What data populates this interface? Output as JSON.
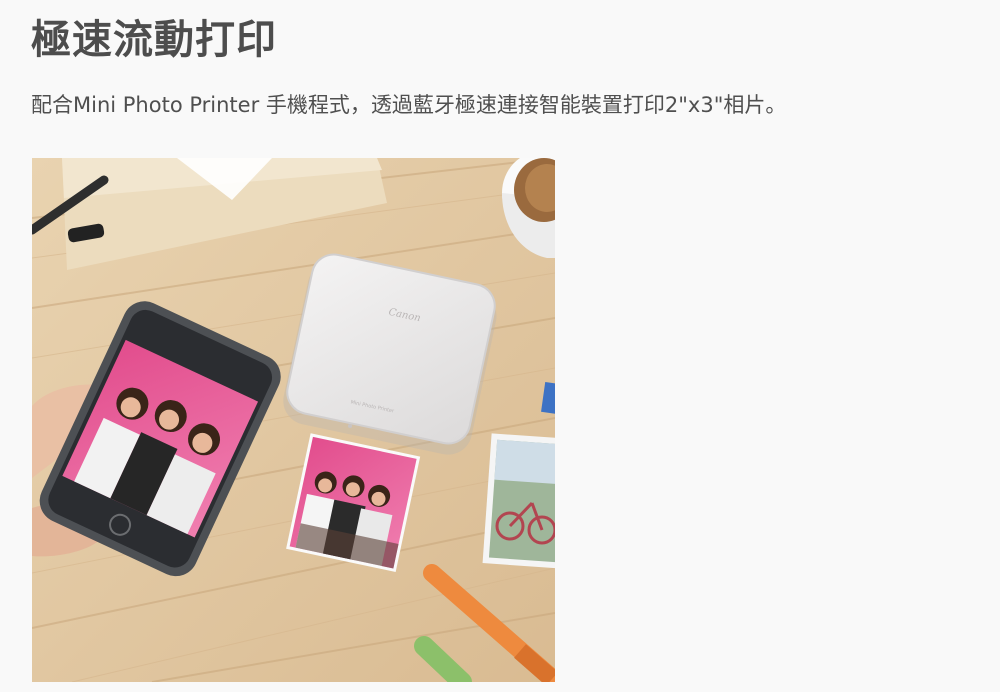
{
  "section": {
    "title": "極速流動打印",
    "description": "配合Mini Photo Printer 手機程式，透過藍牙極速連接智能裝置打印2\"x3\"相片。"
  },
  "product_photo": {
    "printer_brand": "Canon",
    "printer_model": "Mini Photo Printer"
  }
}
